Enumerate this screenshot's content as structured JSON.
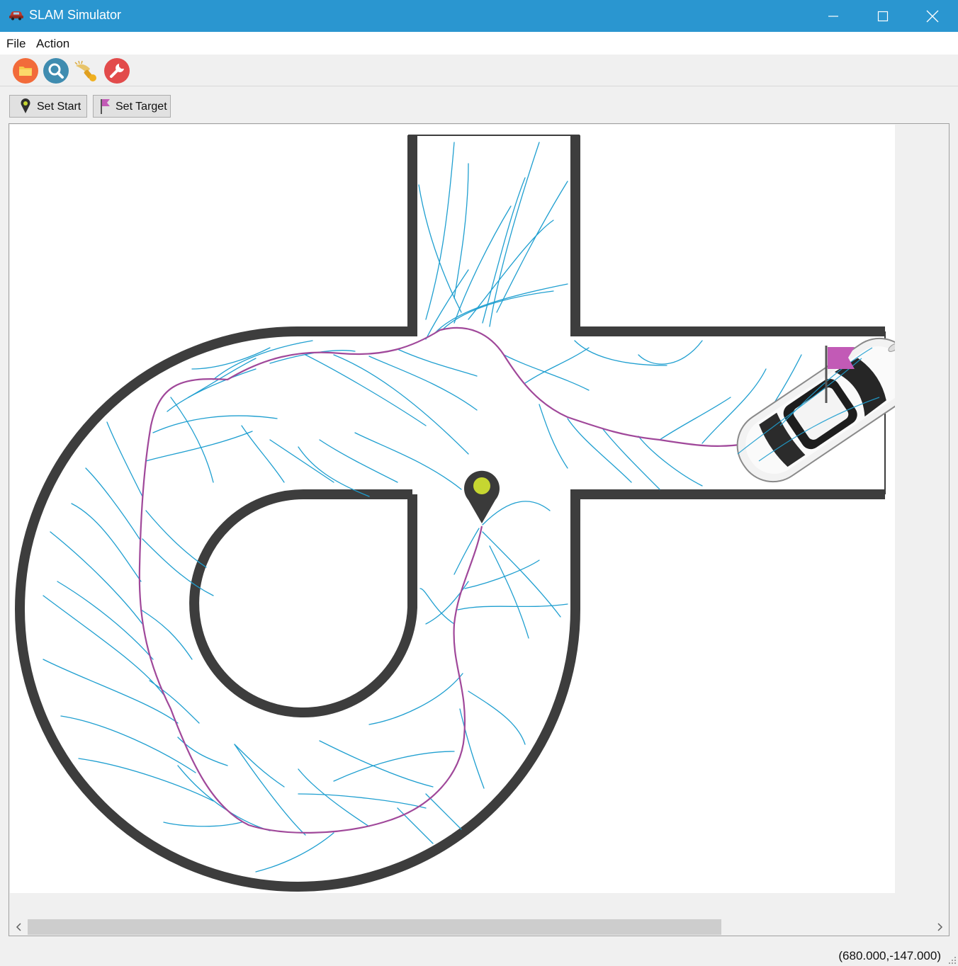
{
  "window": {
    "title": "SLAM Simulator",
    "app_icon": "car-icon",
    "controls": [
      "minimize-icon",
      "maximize-icon",
      "close-icon"
    ]
  },
  "menu": {
    "items": [
      "File",
      "Action"
    ]
  },
  "toolbar": {
    "tools": [
      {
        "name": "open-folder",
        "icon": "folder-icon",
        "color": "#f26b3a"
      },
      {
        "name": "search",
        "icon": "search-icon",
        "color": "#3f8cb0"
      },
      {
        "name": "sweep",
        "icon": "broom-icon",
        "color": "#e8b43a"
      },
      {
        "name": "settings",
        "icon": "wrench-icon",
        "color": "#e24b4b"
      }
    ]
  },
  "buttons": {
    "set_start": "Set Start",
    "set_target": "Set Target"
  },
  "scene": {
    "start_marker": {
      "icon": "map-pin-icon",
      "color": "#3a3a3a",
      "dot": "#c6d631"
    },
    "target_marker": {
      "icon": "flag-icon",
      "color": "#c25ab6"
    },
    "vehicle": "car-icon",
    "colors": {
      "walls": "#3d3d3d",
      "tree": "#1f9fd0",
      "path": "#a0489a"
    }
  },
  "status": {
    "coords": "(680.000,-147.000)"
  }
}
